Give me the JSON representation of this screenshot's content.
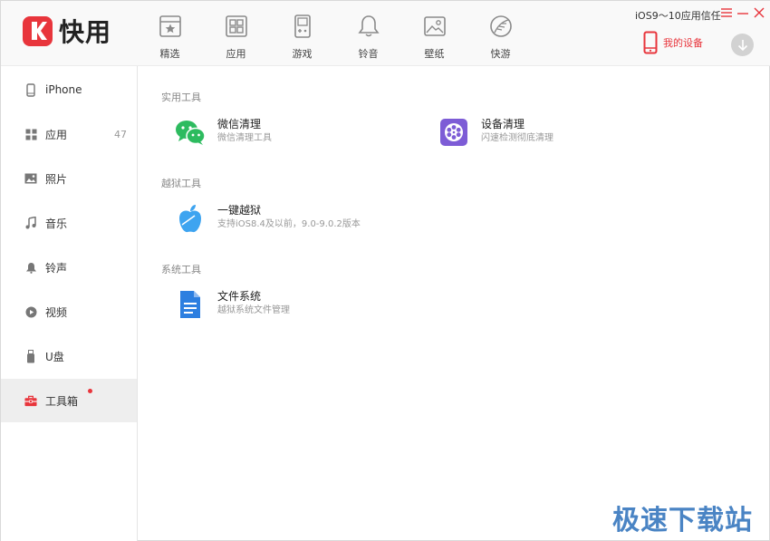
{
  "app": {
    "logo_text": "快用",
    "brand_color": "#e8353c",
    "accent_blue": "#3a87e6"
  },
  "nav": {
    "items": [
      {
        "label": "精选",
        "icon": "star-icon"
      },
      {
        "label": "应用",
        "icon": "apps-grid-icon"
      },
      {
        "label": "游戏",
        "icon": "gameboy-icon"
      },
      {
        "label": "铃音",
        "icon": "bell-icon"
      },
      {
        "label": "壁纸",
        "icon": "image-icon"
      },
      {
        "label": "快游",
        "icon": "leaf-icon"
      }
    ]
  },
  "header": {
    "trust_text": "iOS9～10应用信任",
    "device_label": "我的设备"
  },
  "sidebar": {
    "items": [
      {
        "label": "iPhone",
        "icon": "phone-icon",
        "count": ""
      },
      {
        "label": "应用",
        "icon": "apps-icon",
        "count": "47"
      },
      {
        "label": "照片",
        "icon": "photo-icon",
        "count": ""
      },
      {
        "label": "音乐",
        "icon": "music-icon",
        "count": ""
      },
      {
        "label": "铃声",
        "icon": "bell-icon",
        "count": ""
      },
      {
        "label": "视频",
        "icon": "video-icon",
        "count": ""
      },
      {
        "label": "U盘",
        "icon": "usb-icon",
        "count": ""
      },
      {
        "label": "工具箱",
        "icon": "toolbox-icon",
        "count": "",
        "active": true
      }
    ]
  },
  "main": {
    "sections": [
      {
        "title": "实用工具",
        "tools": [
          {
            "name": "微信清理",
            "desc": "微信清理工具",
            "icon": "wechat-icon"
          },
          {
            "name": "设备清理",
            "desc": "闪速检测彻底清理",
            "icon": "device-clean-icon"
          }
        ]
      },
      {
        "title": "越狱工具",
        "tools": [
          {
            "name": "一键越狱",
            "desc": "支持iOS8.4及以前，9.0-9.0.2版本",
            "icon": "apple-icon"
          }
        ]
      },
      {
        "title": "系统工具",
        "tools": [
          {
            "name": "文件系统",
            "desc": "越狱系统文件管理",
            "icon": "document-icon"
          }
        ]
      }
    ]
  },
  "watermark": "极速下载站"
}
